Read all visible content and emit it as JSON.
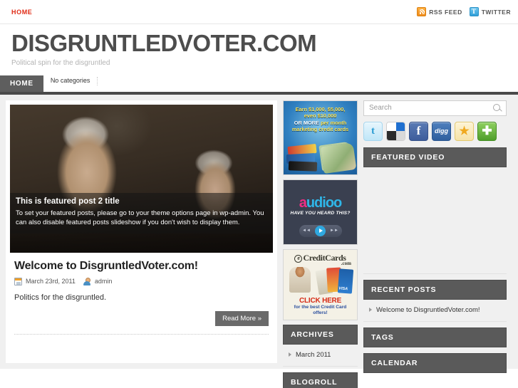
{
  "topbar": {
    "nav": [
      {
        "label": "HOME"
      }
    ],
    "rss_label": "RSS FEED",
    "twitter_label": "TWITTER",
    "twitter_glyph": "t"
  },
  "masthead": {
    "title": "DISGRUNTLEDVOTER.COM",
    "tagline": "Political spin for the disgruntled"
  },
  "mainnav": {
    "home_label": "HOME",
    "categories_label": "No categories"
  },
  "featured": {
    "title": "This is featured post 2 title",
    "text": "To set your featured posts, please go to your theme options page in wp-admin. You can also disable featured posts slideshow if you don't wish to display them."
  },
  "post": {
    "title": "Welcome to DisgruntledVoter.com!",
    "date": "March 23rd, 2011",
    "author": "admin",
    "excerpt": "Politics for the disgruntled.",
    "read_more": "Read More »"
  },
  "ads": [
    {
      "name": "marketing-credit-cards-ad",
      "line1": "Earn $1,000, $5,000,",
      "line2": "even $10,000",
      "line3a": "OR MORE",
      "line3b": "per month",
      "line4": "marketing credit cards"
    },
    {
      "name": "audioo-ad",
      "brand_a": "a",
      "brand_b": "udioo",
      "tagline": "HAVE YOU HEARD THIS?",
      "prev_glyph": "◄◄",
      "next_glyph": "►►"
    },
    {
      "name": "ecreditcards-ad",
      "logo_e": "e",
      "logo_text": "CreditCards",
      "dotcom": ".com",
      "cta_big": "CLICK HERE",
      "cta_small_1": "for the best Credit Card",
      "cta_small_2": "offers!",
      "card_label": "VISA"
    }
  ],
  "archives": {
    "heading": "ARCHIVES",
    "items": [
      {
        "label": "March 2011"
      }
    ]
  },
  "blogroll": {
    "heading": "BLOGROLL"
  },
  "search": {
    "placeholder": "Search",
    "value": ""
  },
  "social_buttons": [
    {
      "name": "twitter-share-button",
      "glyph": "t"
    },
    {
      "name": "delicious-share-button",
      "glyph": ""
    },
    {
      "name": "facebook-share-button",
      "glyph": "f"
    },
    {
      "name": "digg-share-button",
      "glyph": "digg"
    },
    {
      "name": "favorites-button",
      "glyph": "★"
    },
    {
      "name": "add-share-button",
      "glyph": "✚"
    }
  ],
  "sidebar": {
    "featured_video": {
      "heading": "FEATURED VIDEO"
    },
    "recent_posts": {
      "heading": "RECENT POSTS",
      "items": [
        {
          "label": "Welcome to DisgruntledVoter.com!"
        }
      ]
    },
    "tags": {
      "heading": "TAGS"
    },
    "calendar": {
      "heading": "CALENDAR"
    }
  },
  "colors": {
    "accent_red": "#e02b16",
    "nav_dark": "#4a4a4a",
    "widget_head": "#5a5a5a",
    "page_bg": "#f0f0f0"
  }
}
